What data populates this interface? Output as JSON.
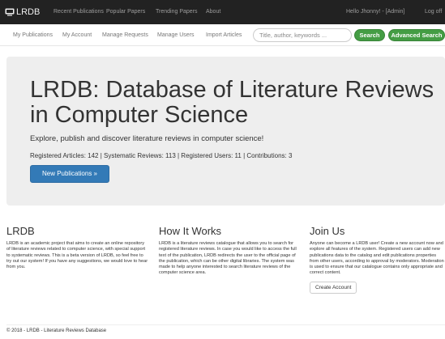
{
  "brand": {
    "name": "LRDB",
    "icon": "monitor-icon"
  },
  "topnav": {
    "items": [
      "Recent Publications",
      "Popular Papers",
      "Trending Papers",
      "About"
    ],
    "greeting": "Hello Jhonny! - [Admin]",
    "logoff": "Log off"
  },
  "subnav": {
    "items": [
      "My Publications",
      "My Account",
      "Manage Requests",
      "Manage Users",
      "Import Articles"
    ],
    "search_placeholder": "Title, author, keywords ...",
    "search_button": "Search",
    "advanced_search_button": "Advanced Search"
  },
  "jumbotron": {
    "title": "LRDB: Database of Literature Reviews in Computer Science",
    "subtitle": "Explore, publish and discover literature reviews in computer science!",
    "stats": "Registered Articles: 142 | Systematic Reviews: 113 | Registered Users: 11 | Contributions: 3",
    "button": "New Publications »"
  },
  "columns": [
    {
      "heading": "LRDB",
      "text": "LRDB is an academic project that aims to create an online repository of literature reviews related to computer science, with special support to systematic reviews. This is a beta version of LRDB, so feel free to try out our system! If you have any suggestions, we would love to hear from you."
    },
    {
      "heading": "How It Works",
      "text": "LRDB is a literature reviews catalogue that allows you to search for registered literature reviews. In case you would like to access the full text of the publication, LRDB redirects the user to the official page of the publication, which can be other digital libraries. The system was made to help anyone interested to search literature reviews of the computer science area."
    },
    {
      "heading": "Join Us",
      "text": "Anyone can become a LRDB user! Create a new account now and explore all features of the system. Registered users can add new publications data to the catalog and edit publications properties from other users, according to approval by moderators. Moderation is used to ensure that our catalogue contains only appropriate and correct content.",
      "button": "Create Account"
    }
  ],
  "footer": "© 2018 - LRDB - Literature Reviews Database",
  "colors": {
    "navbar": "#222222",
    "navbar_text": "#9d9d9d",
    "green_button": "#449d44",
    "blue_button": "#337ab7",
    "jumbotron_bg": "#eeeeee"
  }
}
